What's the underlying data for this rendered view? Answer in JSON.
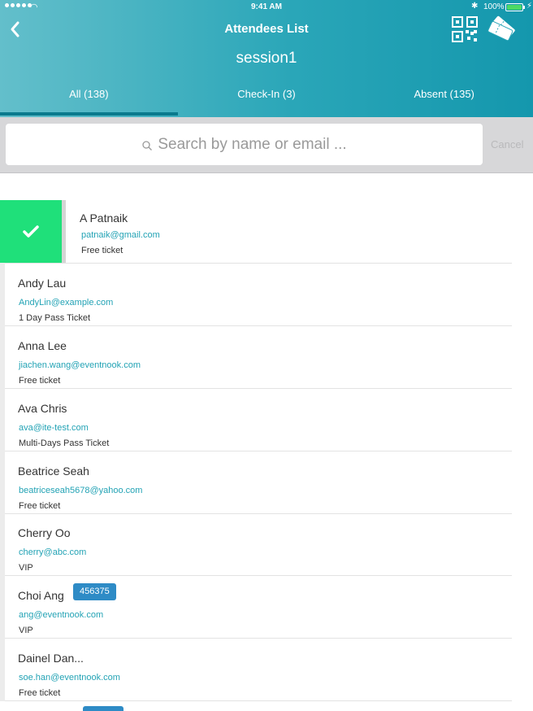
{
  "status_bar": {
    "time": "9:41 AM",
    "battery": "100%"
  },
  "header": {
    "title": "Attendees List",
    "session": "session1",
    "tabs": [
      {
        "label": "All (138)",
        "active": true
      },
      {
        "label": "Check-In (3)",
        "active": false
      },
      {
        "label": "Absent (135)",
        "active": false
      }
    ],
    "icons": [
      "back-chevron-icon",
      "qr-code-icon",
      "tickets-icon"
    ]
  },
  "search": {
    "placeholder": "Search by name or email ...",
    "cancel": "Cancel"
  },
  "colors": {
    "accent": "#23a3b5",
    "checked": "#1fe07a",
    "badge": "#2e8bc6"
  },
  "attendees": [
    {
      "name": "A Patnaik",
      "email": "patnaik@gmail.com",
      "ticket": "Free ticket",
      "checked_in": true
    },
    {
      "name": "Andy Lau",
      "email": "AndyLin@example.com",
      "ticket": "1 Day Pass Ticket"
    },
    {
      "name": "Anna Lee",
      "email": "jiachen.wang@eventnook.com",
      "ticket": "Free ticket"
    },
    {
      "name": "Ava Chris",
      "email": "ava@ite-test.com",
      "ticket": "Multi-Days Pass Ticket"
    },
    {
      "name": "Beatrice Seah",
      "email": "beatriceseah5678@yahoo.com",
      "ticket": "Free ticket"
    },
    {
      "name": "Cherry Oo",
      "email": "cherry@abc.com",
      "ticket": "VIP"
    },
    {
      "name": "Choi Ang",
      "email": "ang@eventnook.com",
      "ticket": "VIP",
      "badge": "456375"
    },
    {
      "name": "Dainel Dan...",
      "email": "soe.han@eventnook.com",
      "ticket": "Free ticket"
    }
  ]
}
